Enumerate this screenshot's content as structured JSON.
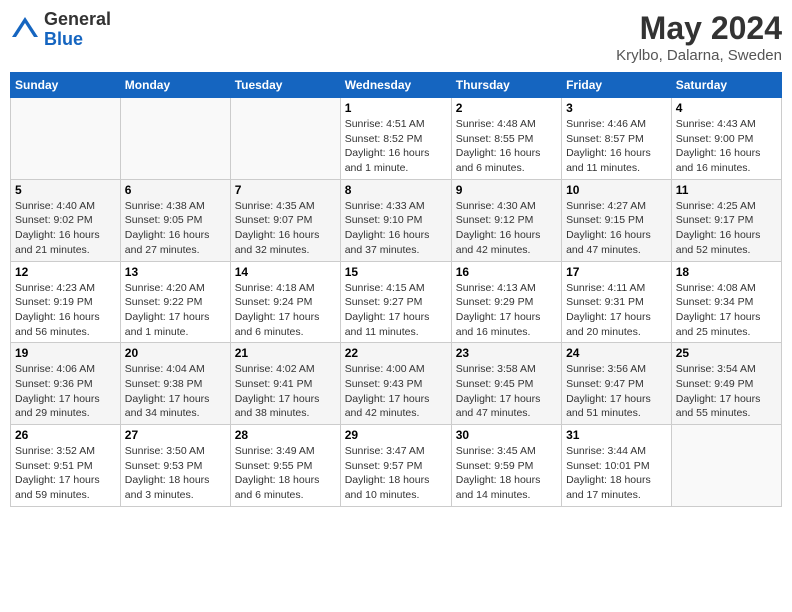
{
  "header": {
    "logo_general": "General",
    "logo_blue": "Blue",
    "month_year": "May 2024",
    "location": "Krylbo, Dalarna, Sweden"
  },
  "weekdays": [
    "Sunday",
    "Monday",
    "Tuesday",
    "Wednesday",
    "Thursday",
    "Friday",
    "Saturday"
  ],
  "weeks": [
    [
      {
        "day": "",
        "info": ""
      },
      {
        "day": "",
        "info": ""
      },
      {
        "day": "",
        "info": ""
      },
      {
        "day": "1",
        "info": "Sunrise: 4:51 AM\nSunset: 8:52 PM\nDaylight: 16 hours\nand 1 minute."
      },
      {
        "day": "2",
        "info": "Sunrise: 4:48 AM\nSunset: 8:55 PM\nDaylight: 16 hours\nand 6 minutes."
      },
      {
        "day": "3",
        "info": "Sunrise: 4:46 AM\nSunset: 8:57 PM\nDaylight: 16 hours\nand 11 minutes."
      },
      {
        "day": "4",
        "info": "Sunrise: 4:43 AM\nSunset: 9:00 PM\nDaylight: 16 hours\nand 16 minutes."
      }
    ],
    [
      {
        "day": "5",
        "info": "Sunrise: 4:40 AM\nSunset: 9:02 PM\nDaylight: 16 hours\nand 21 minutes."
      },
      {
        "day": "6",
        "info": "Sunrise: 4:38 AM\nSunset: 9:05 PM\nDaylight: 16 hours\nand 27 minutes."
      },
      {
        "day": "7",
        "info": "Sunrise: 4:35 AM\nSunset: 9:07 PM\nDaylight: 16 hours\nand 32 minutes."
      },
      {
        "day": "8",
        "info": "Sunrise: 4:33 AM\nSunset: 9:10 PM\nDaylight: 16 hours\nand 37 minutes."
      },
      {
        "day": "9",
        "info": "Sunrise: 4:30 AM\nSunset: 9:12 PM\nDaylight: 16 hours\nand 42 minutes."
      },
      {
        "day": "10",
        "info": "Sunrise: 4:27 AM\nSunset: 9:15 PM\nDaylight: 16 hours\nand 47 minutes."
      },
      {
        "day": "11",
        "info": "Sunrise: 4:25 AM\nSunset: 9:17 PM\nDaylight: 16 hours\nand 52 minutes."
      }
    ],
    [
      {
        "day": "12",
        "info": "Sunrise: 4:23 AM\nSunset: 9:19 PM\nDaylight: 16 hours\nand 56 minutes."
      },
      {
        "day": "13",
        "info": "Sunrise: 4:20 AM\nSunset: 9:22 PM\nDaylight: 17 hours\nand 1 minute."
      },
      {
        "day": "14",
        "info": "Sunrise: 4:18 AM\nSunset: 9:24 PM\nDaylight: 17 hours\nand 6 minutes."
      },
      {
        "day": "15",
        "info": "Sunrise: 4:15 AM\nSunset: 9:27 PM\nDaylight: 17 hours\nand 11 minutes."
      },
      {
        "day": "16",
        "info": "Sunrise: 4:13 AM\nSunset: 9:29 PM\nDaylight: 17 hours\nand 16 minutes."
      },
      {
        "day": "17",
        "info": "Sunrise: 4:11 AM\nSunset: 9:31 PM\nDaylight: 17 hours\nand 20 minutes."
      },
      {
        "day": "18",
        "info": "Sunrise: 4:08 AM\nSunset: 9:34 PM\nDaylight: 17 hours\nand 25 minutes."
      }
    ],
    [
      {
        "day": "19",
        "info": "Sunrise: 4:06 AM\nSunset: 9:36 PM\nDaylight: 17 hours\nand 29 minutes."
      },
      {
        "day": "20",
        "info": "Sunrise: 4:04 AM\nSunset: 9:38 PM\nDaylight: 17 hours\nand 34 minutes."
      },
      {
        "day": "21",
        "info": "Sunrise: 4:02 AM\nSunset: 9:41 PM\nDaylight: 17 hours\nand 38 minutes."
      },
      {
        "day": "22",
        "info": "Sunrise: 4:00 AM\nSunset: 9:43 PM\nDaylight: 17 hours\nand 42 minutes."
      },
      {
        "day": "23",
        "info": "Sunrise: 3:58 AM\nSunset: 9:45 PM\nDaylight: 17 hours\nand 47 minutes."
      },
      {
        "day": "24",
        "info": "Sunrise: 3:56 AM\nSunset: 9:47 PM\nDaylight: 17 hours\nand 51 minutes."
      },
      {
        "day": "25",
        "info": "Sunrise: 3:54 AM\nSunset: 9:49 PM\nDaylight: 17 hours\nand 55 minutes."
      }
    ],
    [
      {
        "day": "26",
        "info": "Sunrise: 3:52 AM\nSunset: 9:51 PM\nDaylight: 17 hours\nand 59 minutes."
      },
      {
        "day": "27",
        "info": "Sunrise: 3:50 AM\nSunset: 9:53 PM\nDaylight: 18 hours\nand 3 minutes."
      },
      {
        "day": "28",
        "info": "Sunrise: 3:49 AM\nSunset: 9:55 PM\nDaylight: 18 hours\nand 6 minutes."
      },
      {
        "day": "29",
        "info": "Sunrise: 3:47 AM\nSunset: 9:57 PM\nDaylight: 18 hours\nand 10 minutes."
      },
      {
        "day": "30",
        "info": "Sunrise: 3:45 AM\nSunset: 9:59 PM\nDaylight: 18 hours\nand 14 minutes."
      },
      {
        "day": "31",
        "info": "Sunrise: 3:44 AM\nSunset: 10:01 PM\nDaylight: 18 hours\nand 17 minutes."
      },
      {
        "day": "",
        "info": ""
      }
    ]
  ]
}
